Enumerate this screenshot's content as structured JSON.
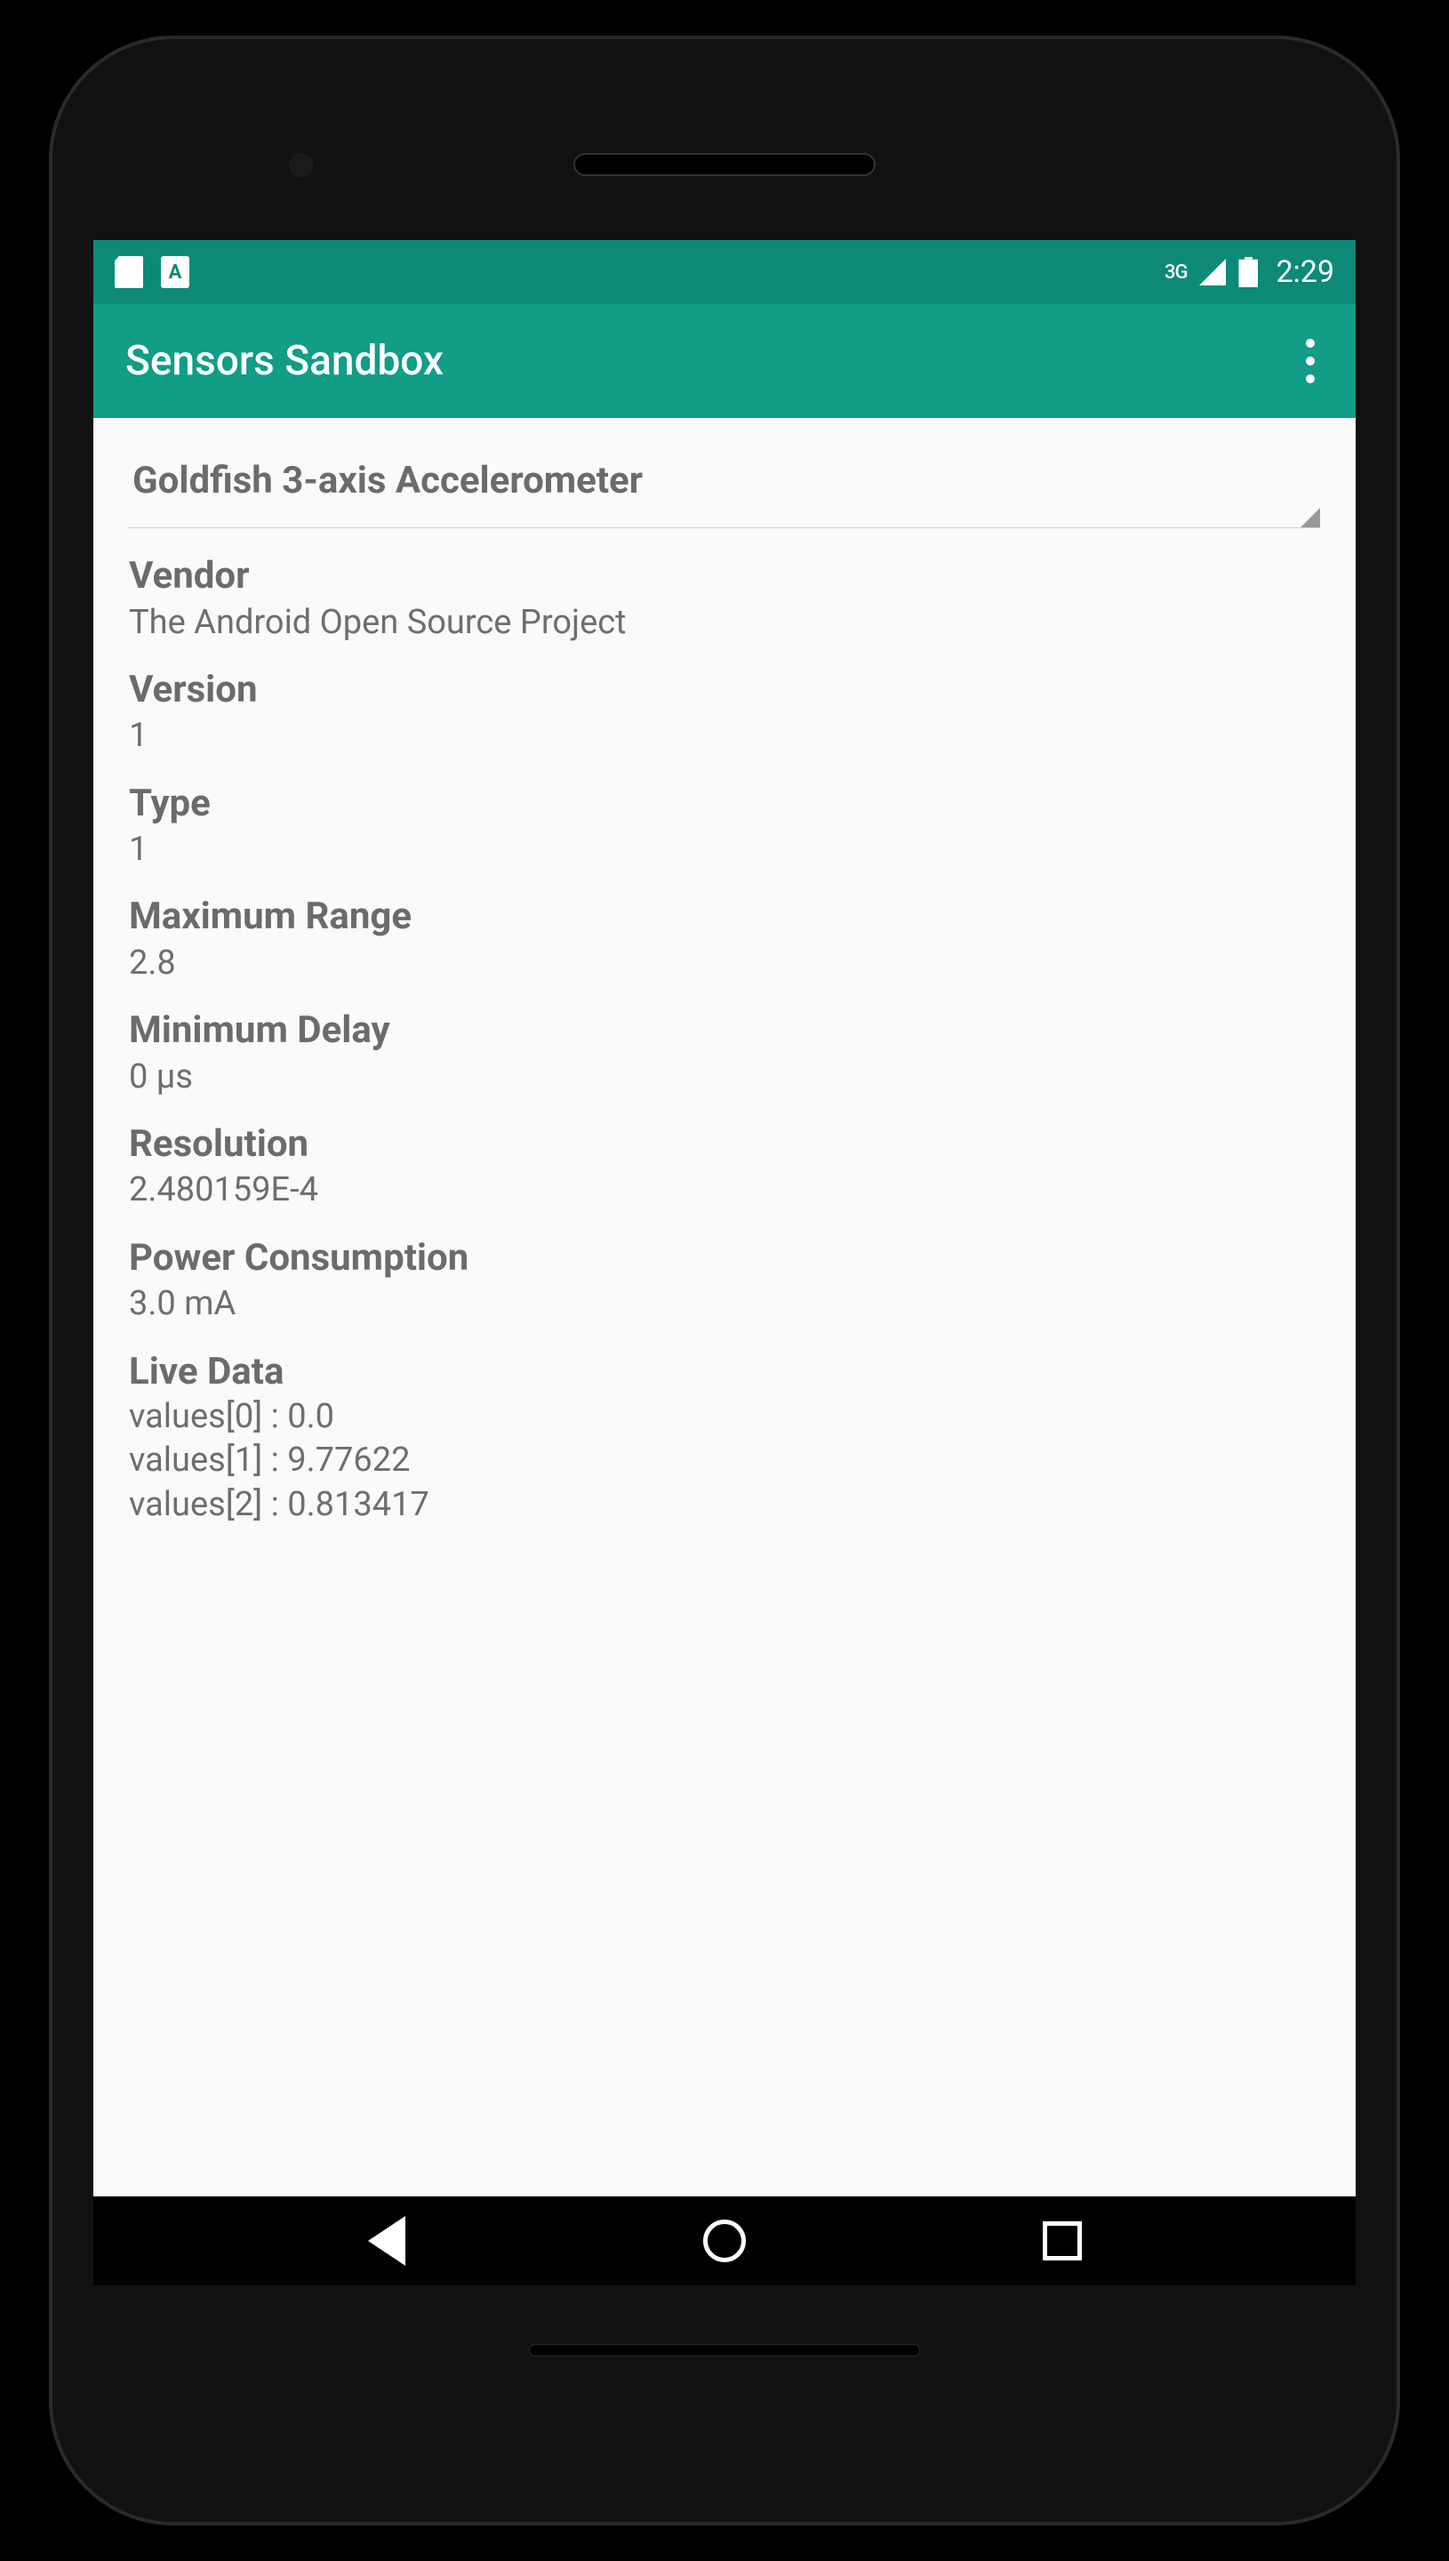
{
  "status_bar": {
    "network_label": "3G",
    "clock": "2:29"
  },
  "app_bar": {
    "title": "Sensors Sandbox"
  },
  "sensor_selector": {
    "selected": "Goldfish 3-axis Accelerometer"
  },
  "fields": {
    "vendor": {
      "label": "Vendor",
      "value": "The Android Open Source Project"
    },
    "version": {
      "label": "Version",
      "value": "1"
    },
    "type": {
      "label": "Type",
      "value": "1"
    },
    "max_range": {
      "label": "Maximum Range",
      "value": "2.8"
    },
    "min_delay": {
      "label": "Minimum Delay",
      "value": "0 µs"
    },
    "resolution": {
      "label": "Resolution",
      "value": "2.480159E-4"
    },
    "power": {
      "label": "Power Consumption",
      "value": "3.0 mA"
    },
    "live": {
      "label": "Live Data",
      "values": [
        "values[0] : 0.0",
        "values[1] : 9.77622",
        "values[2] : 0.813417"
      ]
    }
  }
}
